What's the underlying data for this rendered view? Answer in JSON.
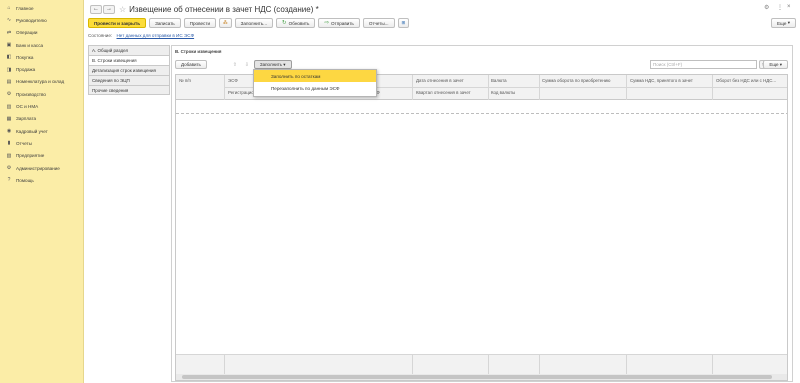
{
  "sidebar": {
    "items": [
      {
        "icon": "home-icon",
        "glyph": "⌂",
        "label": "Главное"
      },
      {
        "icon": "chart-icon",
        "glyph": "∿",
        "label": "Руководителю"
      },
      {
        "icon": "operations-icon",
        "glyph": "⇄",
        "label": "Операции"
      },
      {
        "icon": "bank-icon",
        "glyph": "▣",
        "label": "Банк и касса"
      },
      {
        "icon": "cart-icon",
        "glyph": "◧",
        "label": "Покупка"
      },
      {
        "icon": "sales-icon",
        "glyph": "◨",
        "label": "Продажа"
      },
      {
        "icon": "warehouse-icon",
        "glyph": "▤",
        "label": "Номенклатура и склад"
      },
      {
        "icon": "production-icon",
        "glyph": "⚙",
        "label": "Производство"
      },
      {
        "icon": "fixed-assets-icon",
        "glyph": "▥",
        "label": "ОС и НМА"
      },
      {
        "icon": "salary-icon",
        "glyph": "▦",
        "label": "Зарплата"
      },
      {
        "icon": "hr-icon",
        "glyph": "◉",
        "label": "Кадровый учет"
      },
      {
        "icon": "reports-icon",
        "glyph": "▮",
        "label": "Отчеты"
      },
      {
        "icon": "enterprise-icon",
        "glyph": "▧",
        "label": "Предприятие"
      },
      {
        "icon": "admin-icon",
        "glyph": "⚙",
        "label": "Администрирование"
      },
      {
        "icon": "help-icon",
        "glyph": "?",
        "label": "Помощь"
      }
    ]
  },
  "header": {
    "title": "Извещение об отнесении в зачет НДС (создание) *",
    "back_glyph": "←",
    "forward_glyph": "→",
    "star_glyph": "☆",
    "gear_glyph": "⚙",
    "more_glyph": "⋮",
    "close_glyph": "×"
  },
  "toolbar": {
    "post_close": "Провести и закрыть",
    "save": "Записать",
    "post": "Провести",
    "fill": "Заполнить...",
    "refresh": "Обновить",
    "send": "Отправить",
    "reports": "Отчеты...",
    "more": "Еще"
  },
  "status": {
    "label": "Состояние:",
    "link": "Нет данных для отправки в ИС ЭСФ"
  },
  "tabs": [
    {
      "label": "А. Общий раздел",
      "active": false
    },
    {
      "label": "В. Строки извещения",
      "active": true
    },
    {
      "label": "Детализация строк извещения",
      "active": false
    },
    {
      "label": "Сведения по ЭЦП",
      "active": false
    },
    {
      "label": "Прочие сведения",
      "active": false
    }
  ],
  "panel": {
    "title": "В. Строки извещения",
    "add": "Добавить",
    "fill_dropdown": "Заполнить",
    "search_placeholder": "Поиск (Ctrl+F)",
    "search_clear": "×",
    "more": "Еще"
  },
  "grid": {
    "headers": {
      "num": "№ п/п",
      "esf": "ЭСФ",
      "reg": "Регистрационный номер ЭСФ",
      "esf_right": "ЭСФ",
      "date_credit": "Дата отнесения в зачет",
      "quarter": "Квартал отнесения в зачет",
      "currency": "Валюта",
      "currency_code": "Код валюты",
      "turnover": "Сумма оборота по приобретению",
      "vat": "Сумма НДС, принятого в зачет",
      "turnover_novat": "Оборот без НДС или с НДС..."
    }
  },
  "dropdown": {
    "items": [
      {
        "label": "Заполнить по остаткам",
        "highlight": true
      },
      {
        "label": "Перезаполнить по данным ЭСФ",
        "highlight": false
      }
    ]
  }
}
